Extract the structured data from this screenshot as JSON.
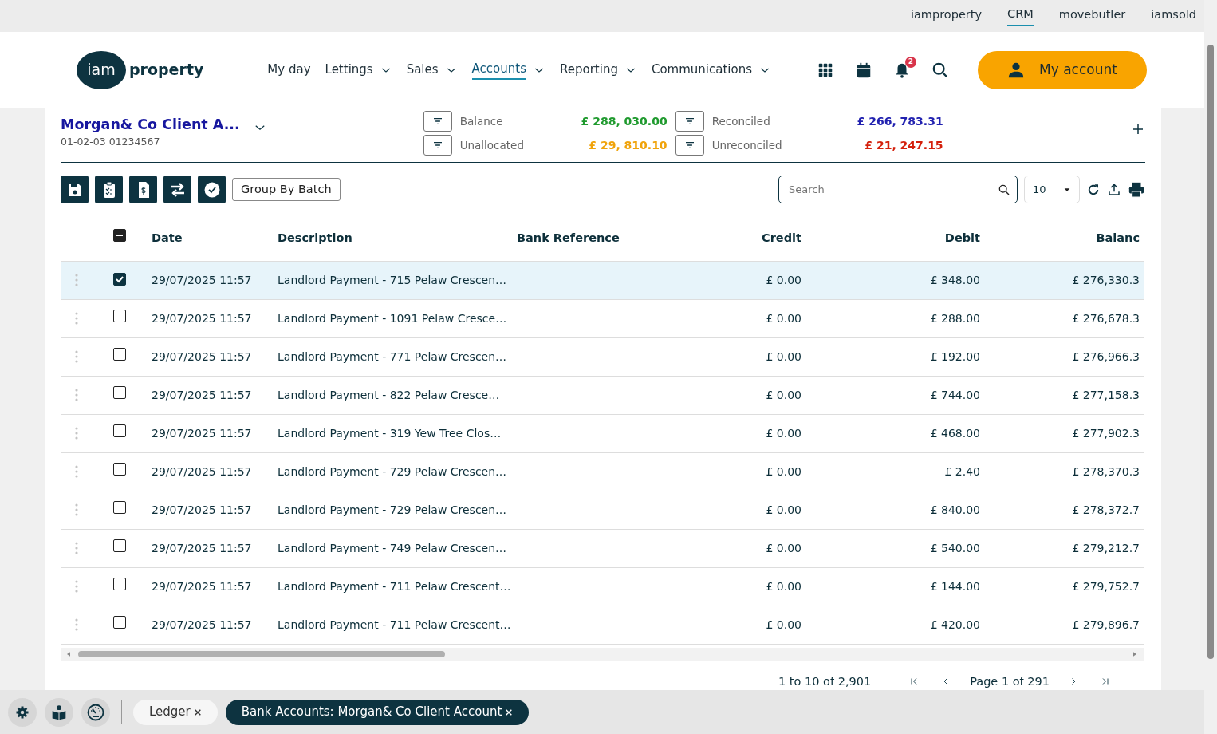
{
  "top_links": [
    {
      "label": "iamproperty",
      "selected": false
    },
    {
      "label": "CRM",
      "selected": true
    },
    {
      "label": "movebutler",
      "selected": false
    },
    {
      "label": "iamsold",
      "selected": false
    }
  ],
  "logo": {
    "badge": "iam",
    "word": "property"
  },
  "nav": [
    {
      "label": "My day",
      "dropdown": false,
      "selected": false
    },
    {
      "label": "Lettings",
      "dropdown": true,
      "selected": false
    },
    {
      "label": "Sales",
      "dropdown": true,
      "selected": false
    },
    {
      "label": "Accounts",
      "dropdown": true,
      "selected": true
    },
    {
      "label": "Reporting",
      "dropdown": true,
      "selected": false
    },
    {
      "label": "Communications",
      "dropdown": true,
      "selected": false
    }
  ],
  "notifications": {
    "count": "2"
  },
  "account_button": "My account",
  "account": {
    "name": "Morgan& Co Client A...",
    "number": "01-02-03 01234567"
  },
  "summary": [
    {
      "label": "Balance",
      "value": "£ 288, 030.00",
      "color": "#1f9a2e"
    },
    {
      "label": "Reconciled",
      "value": "£ 266, 783.31",
      "color": "#2222b0"
    },
    {
      "label": "Unallocated",
      "value": "£ 29, 810.10",
      "color": "#f0a30a"
    },
    {
      "label": "Unreconciled",
      "value": "£ 21, 247.15",
      "color": "#d4200c"
    }
  ],
  "toolbar": {
    "group_button": "Group By Batch",
    "search_placeholder": "Search",
    "page_size": "10"
  },
  "table": {
    "some_checked": true,
    "columns": [
      "Date",
      "Description",
      "Bank Reference",
      "Credit",
      "Debit",
      "Balanc"
    ],
    "rows": [
      {
        "selected": true,
        "date": "29/07/2025 11:57",
        "description": "Landlord Payment - 715 Pelaw Crescen…",
        "credit": "£ 0.00",
        "debit": "£ 348.00",
        "balance": "£ 276,330.3"
      },
      {
        "selected": false,
        "date": "29/07/2025 11:57",
        "description": "Landlord Payment - 1091 Pelaw Cresce…",
        "credit": "£ 0.00",
        "debit": "£ 288.00",
        "balance": "£ 276,678.3"
      },
      {
        "selected": false,
        "date": "29/07/2025 11:57",
        "description": "Landlord Payment - 771 Pelaw Crescen…",
        "credit": "£ 0.00",
        "debit": "£ 192.00",
        "balance": "£ 276,966.3"
      },
      {
        "selected": false,
        "date": "29/07/2025 11:57",
        "description": "Landlord Payment - 822 Pelaw Cresce…",
        "credit": "£ 0.00",
        "debit": "£ 744.00",
        "balance": "£ 277,158.3"
      },
      {
        "selected": false,
        "date": "29/07/2025 11:57",
        "description": "Landlord Payment - 319 Yew Tree Clos…",
        "credit": "£ 0.00",
        "debit": "£ 468.00",
        "balance": "£ 277,902.3"
      },
      {
        "selected": false,
        "date": "29/07/2025 11:57",
        "description": "Landlord Payment - 729 Pelaw Crescen…",
        "credit": "£ 0.00",
        "debit": "£ 2.40",
        "balance": "£ 278,370.3"
      },
      {
        "selected": false,
        "date": "29/07/2025 11:57",
        "description": "Landlord Payment - 729 Pelaw Crescen…",
        "credit": "£ 0.00",
        "debit": "£ 840.00",
        "balance": "£ 278,372.7"
      },
      {
        "selected": false,
        "date": "29/07/2025 11:57",
        "description": "Landlord Payment - 749 Pelaw Crescen…",
        "credit": "£ 0.00",
        "debit": "£ 540.00",
        "balance": "£ 279,212.7"
      },
      {
        "selected": false,
        "date": "29/07/2025 11:57",
        "description": "Landlord Payment - 711 Pelaw Crescent…",
        "credit": "£ 0.00",
        "debit": "£ 144.00",
        "balance": "£ 279,752.7"
      },
      {
        "selected": false,
        "date": "29/07/2025 11:57",
        "description": "Landlord Payment - 711 Pelaw Crescent…",
        "credit": "£ 0.00",
        "debit": "£ 420.00",
        "balance": "£ 279,896.7"
      }
    ]
  },
  "pagination": {
    "range": "1 to 10 of 2,901",
    "page": "Page 1 of 291"
  },
  "taskbar_tabs": [
    {
      "label": "Ledger",
      "selected": false
    },
    {
      "label": "Bank Accounts: Morgan& Co Client Account",
      "selected": true
    }
  ]
}
